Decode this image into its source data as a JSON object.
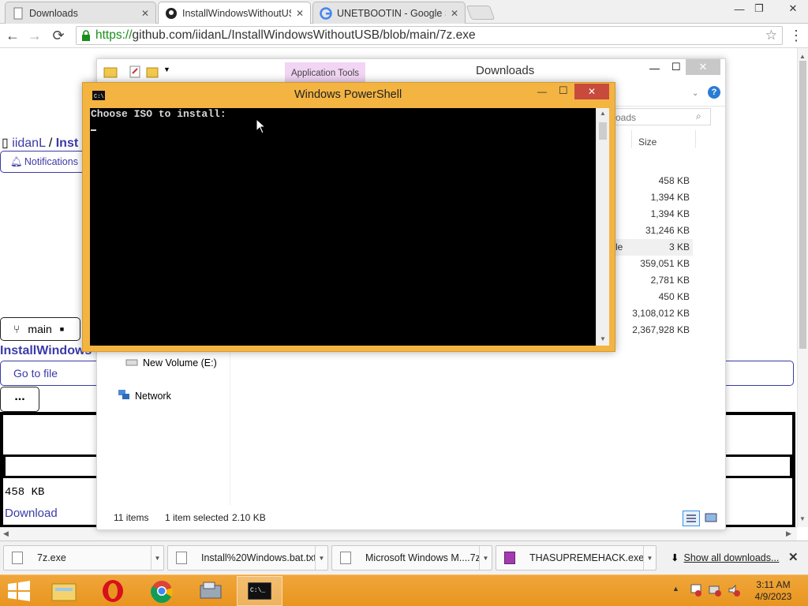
{
  "browser": {
    "tabs": [
      {
        "title": "Downloads",
        "active": false
      },
      {
        "title": "InstallWindowsWithoutUS",
        "active": true
      },
      {
        "title": "UNETBOOTIN - Google Se",
        "active": false
      }
    ],
    "url_scheme": "https://",
    "url_rest": "github.com/iidanL/InstallWindowsWithoutUSB/blob/main/7z.exe"
  },
  "github": {
    "owner": "iidanL",
    "separator": "/",
    "repo_partial": "Inst",
    "notifications_label": "Notifications",
    "branch_label": "main",
    "file_heading_partial": "InstallWindows",
    "go_to_file_label": "Go to file",
    "more_label": "...",
    "file_size": "458 KB",
    "download_label": "Download"
  },
  "explorer": {
    "title": "Downloads",
    "app_tools_label": "Application Tools",
    "search_placeholder": "oads",
    "size_header": "Size",
    "sizes": [
      "458 KB",
      "1,394 KB",
      "1,394 KB",
      "31,246 KB",
      "3 KB",
      "359,051 KB",
      "2,781 KB",
      "450 KB",
      "3,108,012 KB",
      "2,367,928 KB"
    ],
    "selected_row_partial": "le",
    "nav": {
      "volume": "New Volume (E:)",
      "network": "Network"
    },
    "status": {
      "count": "11 items",
      "selected": "1 item selected",
      "selected_size": "2.10 KB"
    }
  },
  "powershell": {
    "title": "Windows PowerShell",
    "prompt": "Choose ISO to install:"
  },
  "downloads_shelf": {
    "items": [
      "7z.exe",
      "Install%20Windows.bat.txt",
      "Microsoft Windows M....7z",
      "THASUPREMEHACK.exe"
    ],
    "show_all": "Show all downloads..."
  },
  "taskbar": {
    "time": "3:11 AM",
    "date": "4/9/2023"
  },
  "colors": {
    "taskbar": "#e8951f",
    "powershell_frame": "#f3b442",
    "console_bg": "#000000",
    "link": "#3a3aa8",
    "https_green": "#1a8d1a"
  }
}
